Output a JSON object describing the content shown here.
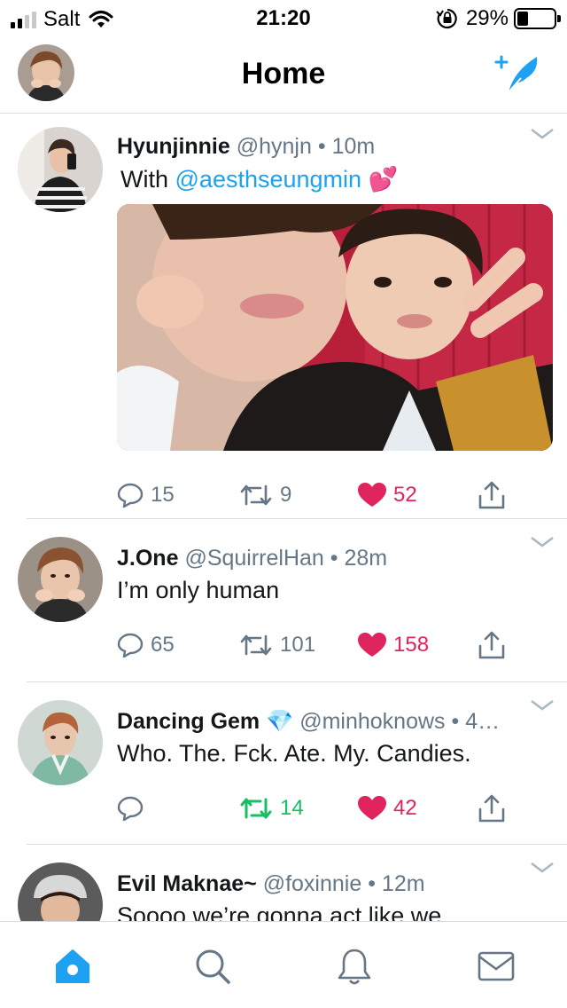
{
  "status_bar": {
    "carrier": "Salt",
    "time": "21:20",
    "battery_percent": "29%",
    "battery_level": 0.29,
    "signal_bars": 4,
    "signal_active": 2,
    "icons": [
      "signal-icon",
      "wifi-icon",
      "rotation-lock-icon",
      "battery-icon"
    ]
  },
  "header": {
    "title": "Home",
    "compose_icon": "compose-tweet-icon",
    "avatar_icon": "profile-avatar"
  },
  "colors": {
    "accent": "#1da1f2",
    "like": "#e0245e",
    "retweet_active": "#17bf63",
    "secondary_text": "#657786",
    "divider": "#d8dde1"
  },
  "tweets": [
    {
      "name": "Hyunjinnie",
      "handle": "@hynjn",
      "dot": "•",
      "time": "10m",
      "text_prefix": "With ",
      "mention": "@aesthseungmin",
      "emoji": "💕",
      "has_media": true,
      "replies": "15",
      "retweets": "9",
      "likes": "52",
      "liked": true,
      "retweeted": false
    },
    {
      "name": "J.One",
      "handle": "@SquirrelHan",
      "dot": "•",
      "time": "28m",
      "text": "I’m only human",
      "replies": "65",
      "retweets": "101",
      "likes": "158",
      "liked": true,
      "retweeted": false
    },
    {
      "name": "Dancing Gem",
      "badge": "💎",
      "handle": "@minhoknows",
      "dot": "•",
      "time": "4…",
      "text": "Who. The. Fck. Ate. My. Candies.",
      "replies": "",
      "retweets": "14",
      "likes": "42",
      "liked": true,
      "retweeted": true
    },
    {
      "name": "Evil Maknae~",
      "handle": "@foxinnie",
      "dot": "•",
      "time": "12m",
      "text": "Soooo we’re gonna act like we"
    }
  ],
  "tabs": [
    {
      "icon": "home-icon",
      "active": true
    },
    {
      "icon": "search-icon",
      "active": false
    },
    {
      "icon": "notifications-bell-icon",
      "active": false
    },
    {
      "icon": "messages-envelope-icon",
      "active": false
    }
  ]
}
